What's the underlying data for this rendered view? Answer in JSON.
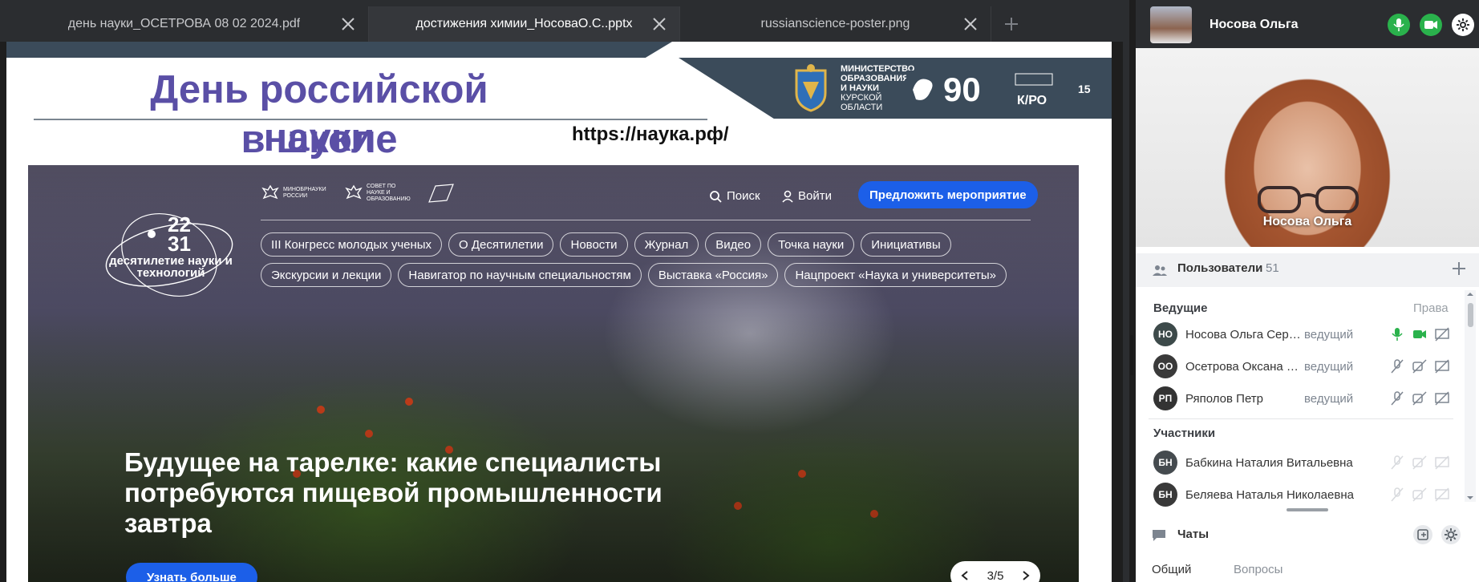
{
  "tabs": [
    {
      "label": "день науки_ОСЕТРОВА 08 02 2024.pdf",
      "active": false
    },
    {
      "label": "достижения химии_НосоваО.С..pptx",
      "active": true
    },
    {
      "label": "russianscience-poster.png",
      "active": false
    }
  ],
  "slide": {
    "title_line1": "День российской науки",
    "title_line2": "в школе",
    "url": "https://наука.рф/",
    "ministry_bold": "МИНИСТЕРСТВО ОБРАЗОВАНИЯ И НАУКИ",
    "ministry_region": "КУРСКОЙ ОБЛАСТИ",
    "badge": "90",
    "badge_sub": "К/РО",
    "page_number": "15"
  },
  "site": {
    "logo1": "МИНОБРНАУКИ РОССИИ",
    "logo2": "СОВЕТ ПО НАУКЕ И ОБРАЗОВАНИЮ",
    "decade_nums": "22\n31",
    "decade_text": "десятилетие науки и технологий",
    "search": "Поиск",
    "login": "Войти",
    "cta": "Предложить мероприятие",
    "nav": [
      "III Конгресс молодых ученых",
      "О Десятилетии",
      "Новости",
      "Журнал",
      "Видео",
      "Точка науки",
      "Инициативы",
      "Экскурсии и лекции",
      "Навигатор по научным специальностям",
      "Выставка «Россия»",
      "Нацпроект «Наука и университеты»"
    ],
    "headline": "Будущее на тарелке: какие специалисты потребуются пищевой промышленности завтра",
    "more": "Узнать больше",
    "pager": "3/5"
  },
  "presenter": {
    "name": "Носова Ольга",
    "video_name": "Носова Ольга"
  },
  "users": {
    "title": "Пользователи",
    "count": "51",
    "hosts_label": "Ведущие",
    "rights_label": "Права",
    "participants_label": "Участники",
    "hosts": [
      {
        "initials": "НО",
        "name": "Носова Ольга Сергеевна",
        "role": "ведущий",
        "color": "#3d4a4a"
      },
      {
        "initials": "ОО",
        "name": "Осетрова Оксана Алексеевна",
        "role": "ведущий",
        "color": "#3a3a3a"
      },
      {
        "initials": "РП",
        "name": "Ряполов Петр",
        "role": "ведущий",
        "color": "#333333"
      }
    ],
    "participants": [
      {
        "initials": "БН",
        "name": "Бабкина Наталия Витальевна",
        "color": "#454b4f"
      },
      {
        "initials": "БН",
        "name": "Беляева Наталья Николаевна",
        "color": "#393939"
      }
    ]
  },
  "chats": {
    "title": "Чаты",
    "tab_general": "Общий",
    "tab_questions": "Вопросы"
  },
  "colors": {
    "accent_green": "#2ab24c",
    "site_blue": "#1c5fe8",
    "slide_title": "#5a4fa6"
  }
}
